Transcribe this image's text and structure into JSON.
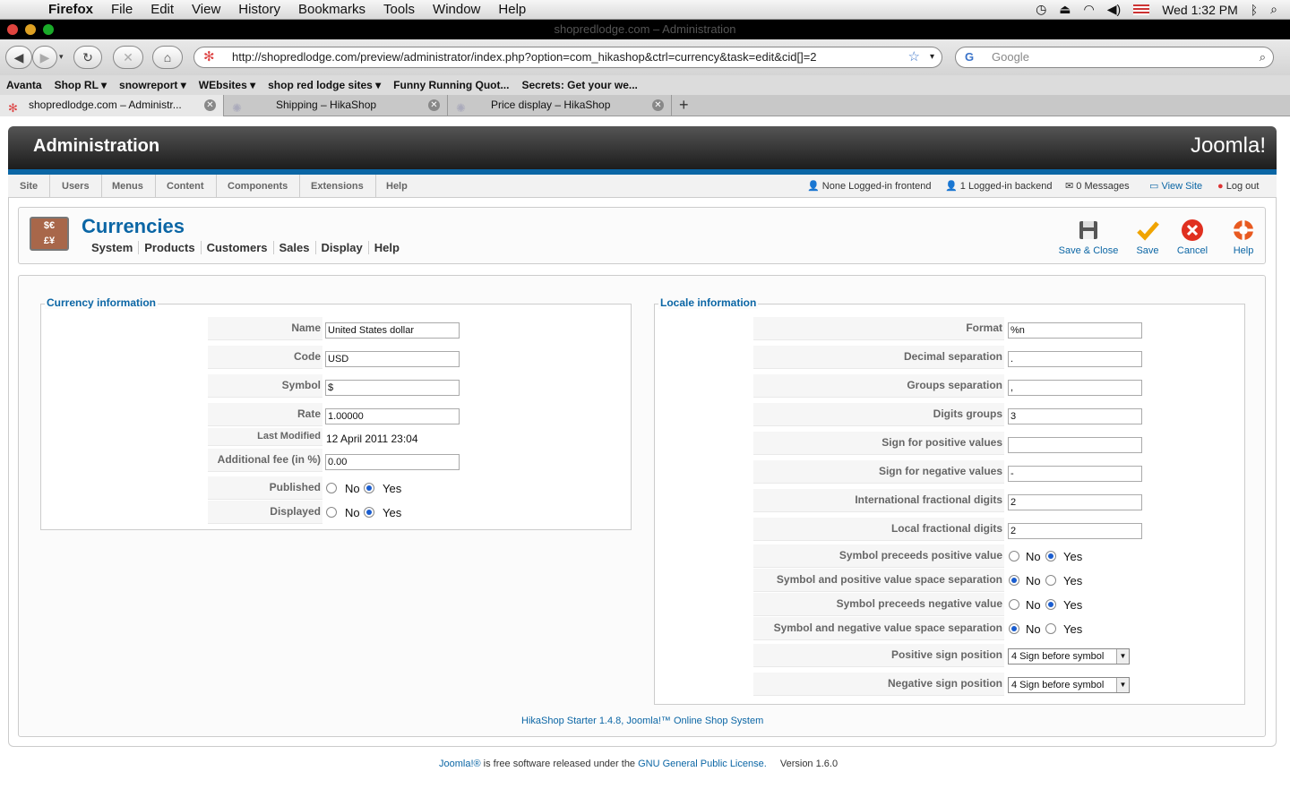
{
  "mac_menu": {
    "app": "Firefox",
    "items": [
      "File",
      "Edit",
      "View",
      "History",
      "Bookmarks",
      "Tools",
      "Window",
      "Help"
    ],
    "clock": "Wed 1:32 PM"
  },
  "window_title": "shopredlodge.com – Administration",
  "url": "http://shopredlodge.com/preview/administrator/index.php?option=com_hikashop&ctrl=currency&task=edit&cid[]=2",
  "search_placeholder": "Google",
  "bookmarks": [
    "Avanta",
    "Shop RL ▾",
    "snowreport ▾",
    "WEbsites ▾",
    "shop red lodge sites ▾",
    "Funny Running Quot...",
    "Secrets: Get your we..."
  ],
  "tabs": [
    "shopredlodge.com – Administr...",
    "Shipping – HikaShop",
    "Price display – HikaShop"
  ],
  "header": {
    "title": "Administration",
    "logo": "Joomla!"
  },
  "menu": [
    "Site",
    "Users",
    "Menus",
    "Content",
    "Components",
    "Extensions",
    "Help"
  ],
  "status": {
    "frontend": "None Logged-in frontend",
    "backend": "1 Logged-in backend",
    "messages": "0 Messages",
    "view_site": "View Site",
    "logout": "Log out"
  },
  "page": {
    "title": "Currencies",
    "icon_text": "$€\n£¥",
    "submenu": [
      "System",
      "Products",
      "Customers",
      "Sales",
      "Display",
      "Help"
    ]
  },
  "toolbar": {
    "save_close": "Save & Close",
    "save": "Save",
    "cancel": "Cancel",
    "help": "Help"
  },
  "currency": {
    "legend": "Currency information",
    "name_label": "Name",
    "name": "United States dollar",
    "code_label": "Code",
    "code": "USD",
    "symbol_label": "Symbol",
    "symbol": "$",
    "rate_label": "Rate",
    "rate": "1.00000",
    "modified_label": "Last Modified",
    "modified": "12 April 2011 23:04",
    "fee_label": "Additional fee (in %)",
    "fee": "0.00",
    "published_label": "Published",
    "displayed_label": "Displayed",
    "no": "No",
    "yes": "Yes"
  },
  "locale": {
    "legend": "Locale information",
    "format_label": "Format",
    "format": "%n",
    "decimal_label": "Decimal separation",
    "decimal": ".",
    "groups_label": "Groups separation",
    "groups": ",",
    "digits_label": "Digits groups",
    "digits": "3",
    "pos_sign_label": "Sign for positive values",
    "pos_sign": "",
    "neg_sign_label": "Sign for negative values",
    "neg_sign": "-",
    "intl_frac_label": "International fractional digits",
    "intl_frac": "2",
    "local_frac_label": "Local fractional digits",
    "local_frac": "2",
    "sym_pre_pos_label": "Symbol preceeds positive value",
    "sym_space_pos_label": "Symbol and positive value space separation",
    "sym_pre_neg_label": "Symbol preceeds negative value",
    "sym_space_neg_label": "Symbol and negative value space separation",
    "pos_pos_label": "Positive sign position",
    "pos_pos": "4 Sign before symbol",
    "neg_pos_label": "Negative sign position",
    "neg_pos": "4 Sign before symbol",
    "no": "No",
    "yes": "Yes"
  },
  "footer": {
    "hika": "HikaShop Starter 1.4.8, Joomla!™ Online Shop System",
    "joomla_link": "Joomla!®",
    "joomla_text": " is free software released under the ",
    "gpl": "GNU General Public License.",
    "version": "Version 1.6.0"
  }
}
